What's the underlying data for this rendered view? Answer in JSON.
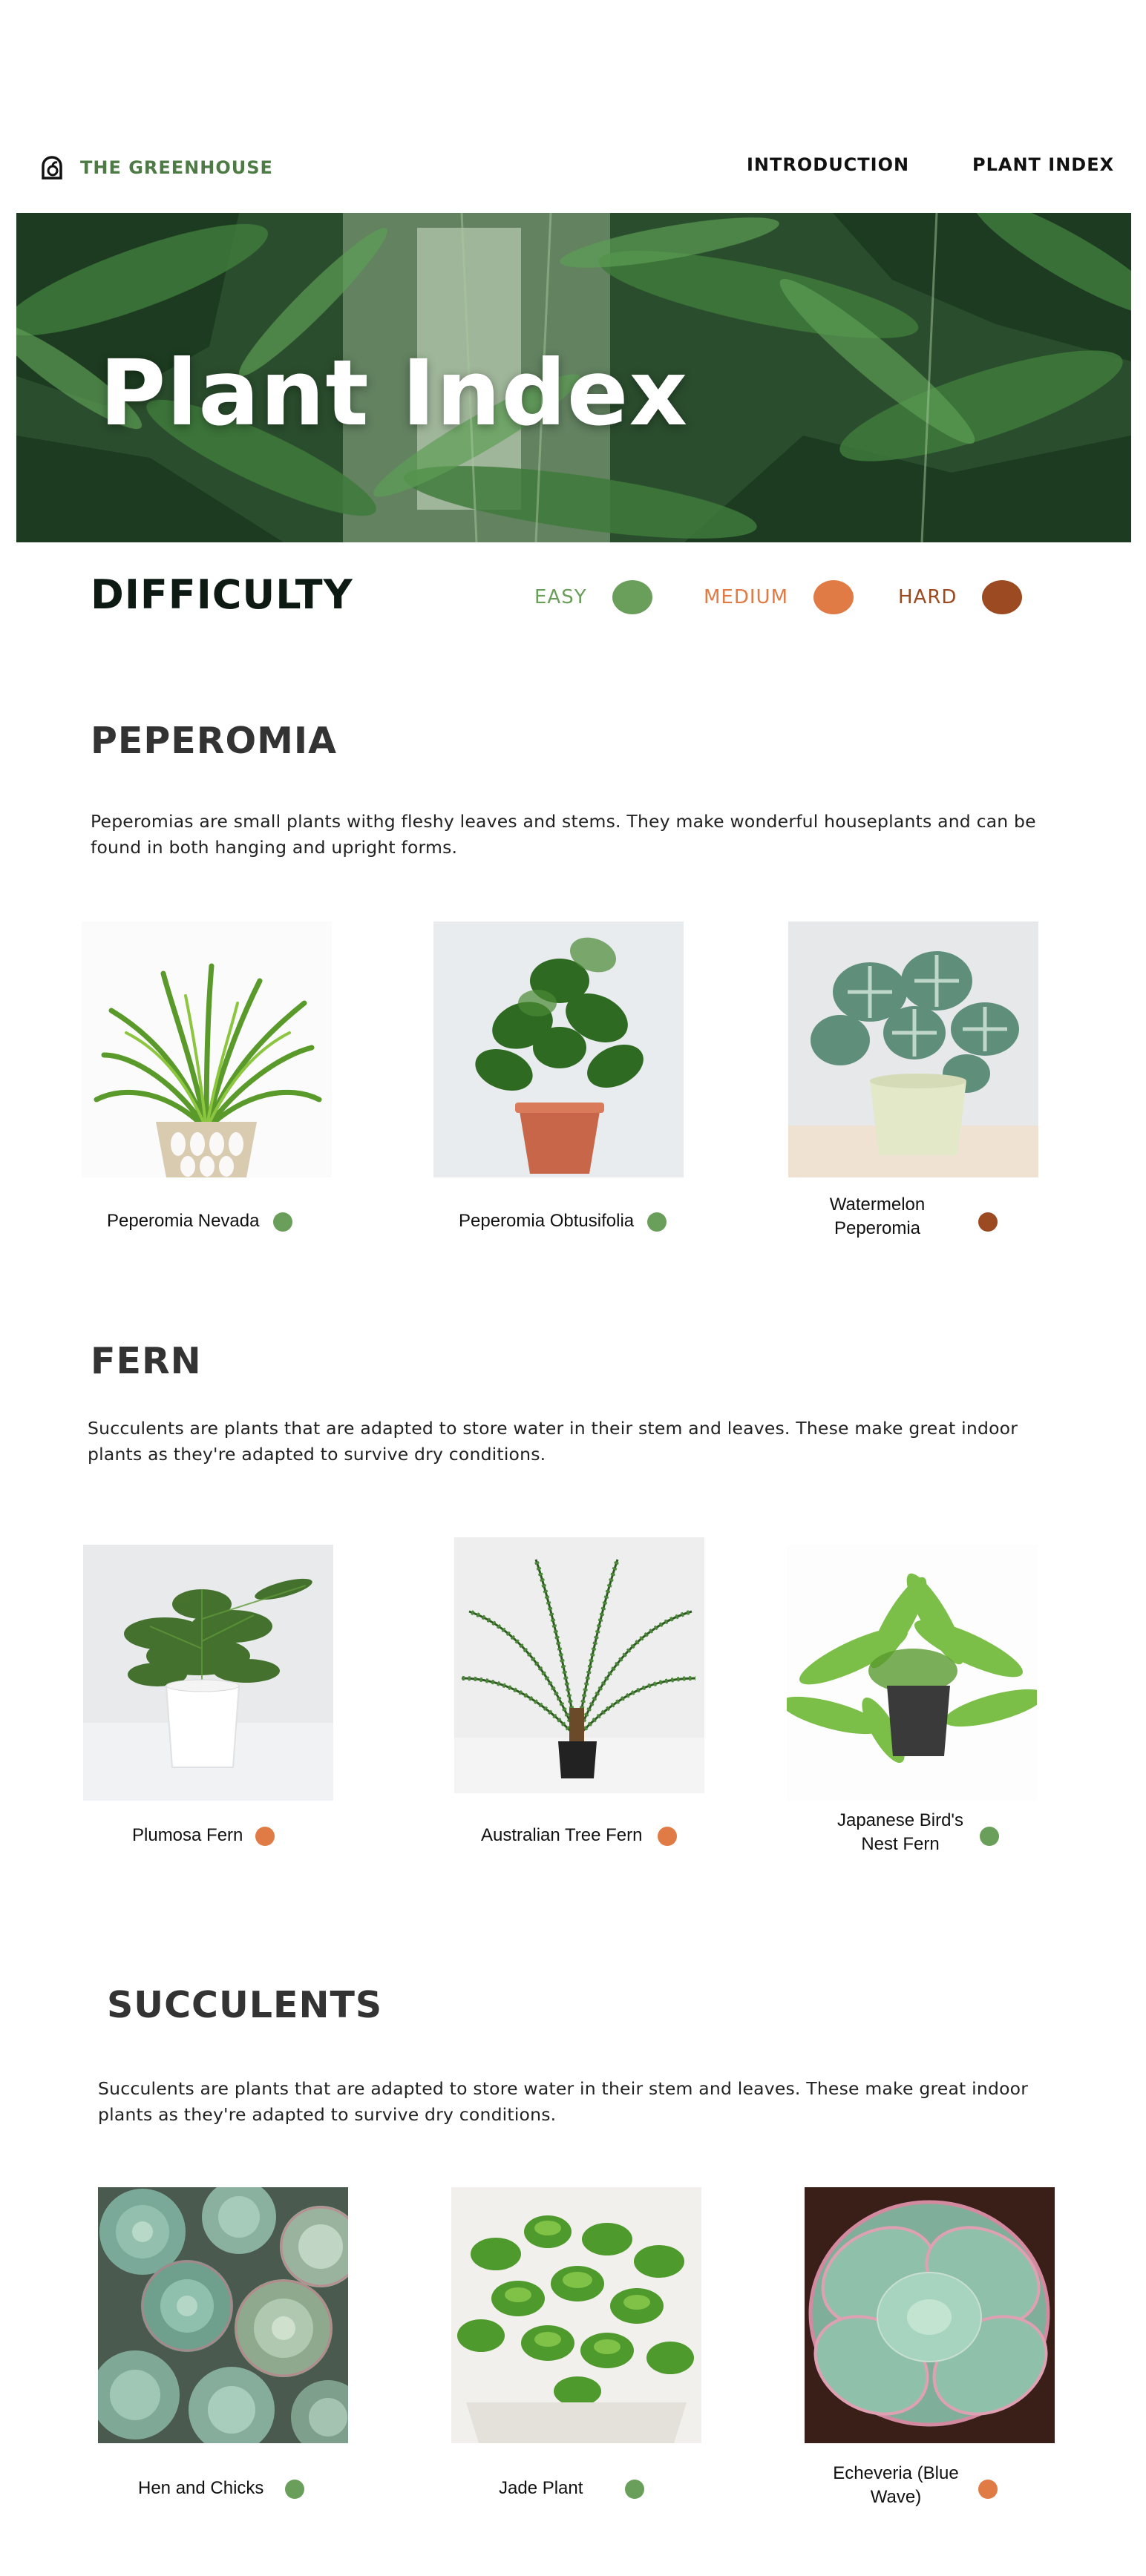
{
  "colors": {
    "easy": "#6a9e5b",
    "medium": "#e07b45",
    "hard": "#9c4a21",
    "brand": "#4e7a45"
  },
  "brand": {
    "name": "THE GREENHOUSE",
    "icon": "greenhouse-logo-icon"
  },
  "nav": {
    "introduction": "INTRODUCTION",
    "plant_index": "PLANT INDEX"
  },
  "hero": {
    "title": "Plant Index"
  },
  "difficulty": {
    "title": "DIFFICULTY",
    "levels": [
      {
        "label": "EASY",
        "color": "#6a9e5b"
      },
      {
        "label": "MEDIUM",
        "color": "#e07b45"
      },
      {
        "label": "HARD",
        "color": "#9c4a21"
      }
    ]
  },
  "sections": [
    {
      "title": "PEPEROMIA",
      "description": "Peperomias are small plants withg fleshy leaves and stems. They make wonderful houseplants and can be found in both hanging and upright forms.",
      "plants": [
        {
          "name": "Peperomia Nevada",
          "difficulty": "easy"
        },
        {
          "name": "Peperomia Obtusifolia",
          "difficulty": "easy"
        },
        {
          "name": "Watermelon Peperomia",
          "difficulty": "hard"
        }
      ]
    },
    {
      "title": "FERN",
      "description": "Succulents are plants that are adapted to store water in their stem and leaves. These make great indoor plants as they're adapted to survive dry conditions.",
      "plants": [
        {
          "name": "Plumosa Fern",
          "difficulty": "medium"
        },
        {
          "name": "Australian Tree Fern",
          "difficulty": "medium"
        },
        {
          "name": "Japanese Bird's Nest Fern",
          "difficulty": "easy"
        }
      ]
    },
    {
      "title": "SUCCULENTS",
      "description": "Succulents are plants that are adapted to store water in their stem and leaves. These make great indoor plants as they're adapted to survive dry conditions.",
      "plants": [
        {
          "name": "Hen and Chicks",
          "difficulty": "easy"
        },
        {
          "name": "Jade Plant",
          "difficulty": "easy"
        },
        {
          "name": "Echeveria (Blue Wave)",
          "difficulty": "medium"
        }
      ]
    }
  ]
}
